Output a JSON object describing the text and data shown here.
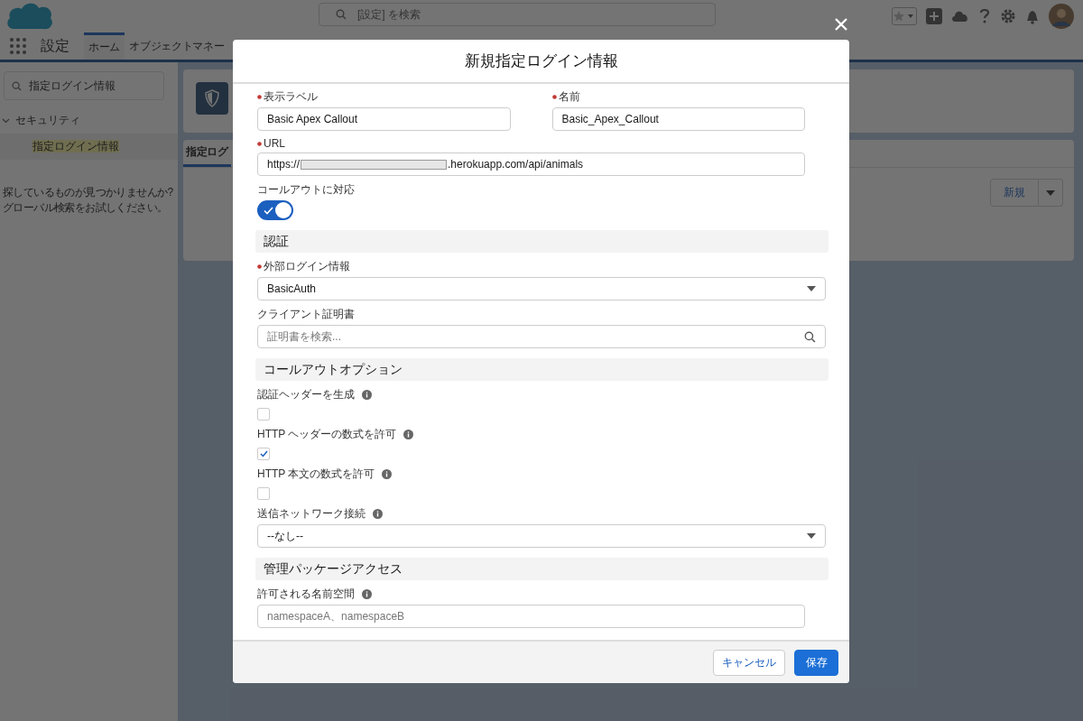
{
  "header": {
    "search_placeholder": "[設定] を検索"
  },
  "nav": {
    "app_name": "設定",
    "tabs": [
      {
        "label": "ホーム",
        "selected": true
      },
      {
        "label": "オブジェクトマネー",
        "selected": false
      }
    ]
  },
  "sidebar": {
    "quick_find": "指定ログイン情報",
    "tree": [
      {
        "label": "セキュリティ",
        "expanded": true,
        "children": [
          {
            "label": "指定ログイン情報",
            "selected": true
          }
        ]
      }
    ],
    "help_lines": [
      "探しているものが見つかりませんか?",
      "グローバル検索をお試しください。"
    ]
  },
  "page": {
    "list_tab": "指定ログ",
    "new_button": "新規"
  },
  "modal": {
    "title": "新規指定ログイン情報",
    "rows": [
      {
        "kind": "pair",
        "fields": [
          {
            "label": "表示ラベル",
            "required": true,
            "value": "Basic Apex Callout"
          },
          {
            "label": "名前",
            "required": true,
            "value": "Basic_Apex_Callout"
          }
        ]
      },
      {
        "kind": "url",
        "label": "URL",
        "required": true,
        "prefix": "https://",
        "suffix": ".herokuapp.com/api/animals"
      },
      {
        "kind": "toggle",
        "label": "コールアウトに対応",
        "on": true
      },
      {
        "kind": "heading",
        "label": "認証"
      },
      {
        "kind": "select",
        "label": "外部ログイン情報",
        "required": true,
        "value": "BasicAuth",
        "info": false
      },
      {
        "kind": "lookup",
        "label": "クライアント証明書",
        "required": false,
        "placeholder": "証明書を検索..."
      },
      {
        "kind": "heading",
        "label": "コールアウトオプション"
      },
      {
        "kind": "checkbox",
        "label": "認証ヘッダーを生成",
        "checked": false,
        "info": true
      },
      {
        "kind": "checkbox",
        "label": "HTTP ヘッダーの数式を許可",
        "checked": true,
        "info": true
      },
      {
        "kind": "checkbox",
        "label": "HTTP 本文の数式を許可",
        "checked": false,
        "info": true
      },
      {
        "kind": "select",
        "label": "送信ネットワーク接続",
        "required": false,
        "value": "--なし--",
        "info": true
      },
      {
        "kind": "heading",
        "label": "管理パッケージアクセス"
      },
      {
        "kind": "text",
        "label": "許可される名前空間",
        "required": false,
        "placeholder": "namespaceA、namespaceB",
        "info": true
      }
    ],
    "cancel_button": "キャンセル",
    "save_button": "保存"
  }
}
